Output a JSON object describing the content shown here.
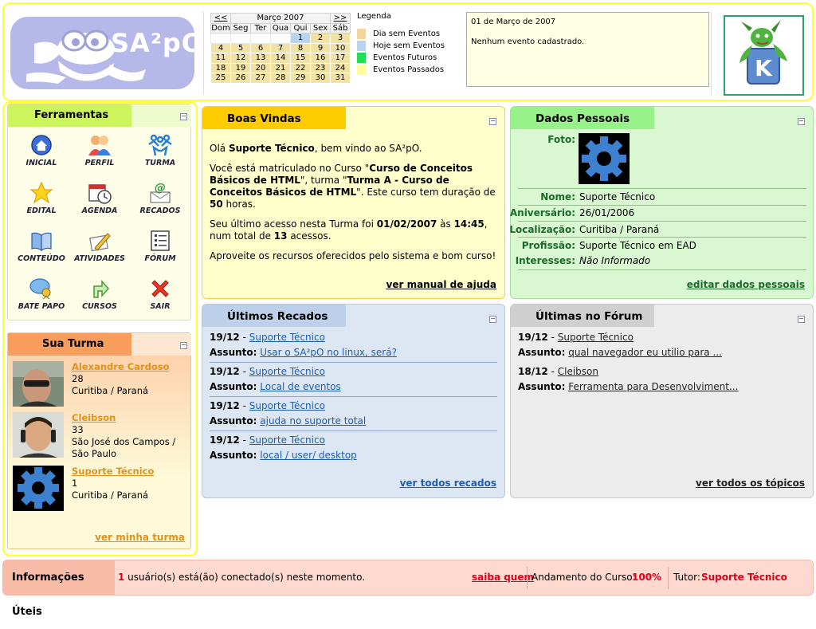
{
  "logo": {
    "text": "SA²pO"
  },
  "calendar": {
    "prev": "<<",
    "next": ">>",
    "month": "Março 2007",
    "weekdays": [
      "Dom",
      "Seg",
      "Ter",
      "Qua",
      "Qui",
      "Sex",
      "Sáb"
    ],
    "weeks": [
      [
        "",
        "",
        "",
        "",
        "1",
        "2",
        "3"
      ],
      [
        "4",
        "5",
        "6",
        "7",
        "8",
        "9",
        "10"
      ],
      [
        "11",
        "12",
        "13",
        "14",
        "15",
        "16",
        "17"
      ],
      [
        "18",
        "19",
        "20",
        "21",
        "22",
        "23",
        "24"
      ],
      [
        "25",
        "26",
        "27",
        "28",
        "29",
        "30",
        "31"
      ]
    ],
    "today": "1"
  },
  "legend": {
    "title": "Legenda",
    "items": [
      {
        "label": "Dia sem Eventos",
        "color": "#f3d39e"
      },
      {
        "label": "Hoje sem Eventos",
        "color": "#b9d4ee"
      },
      {
        "label": "Eventos Futuros",
        "color": "#22dd55"
      },
      {
        "label": "Eventos Passados",
        "color": "#ffff99"
      }
    ]
  },
  "event_box": {
    "date": "01 de Março de 2007",
    "message": "Nenhum evento cadastrado."
  },
  "tools": {
    "title": "Ferramentas",
    "items": [
      {
        "label": "INICIAL",
        "icon": "home-icon"
      },
      {
        "label": "PERFIL",
        "icon": "profile-icon"
      },
      {
        "label": "TURMA",
        "icon": "class-icon"
      },
      {
        "label": "EDITAL",
        "icon": "star-icon"
      },
      {
        "label": "AGENDA",
        "icon": "calendar-clock-icon"
      },
      {
        "label": "RECADOS",
        "icon": "message-icon"
      },
      {
        "label": "CONTEÚDO",
        "icon": "book-icon"
      },
      {
        "label": "ATIVIDADES",
        "icon": "pencil-icon"
      },
      {
        "label": "FÓRUM",
        "icon": "forum-icon"
      },
      {
        "label": "BATE PAPO",
        "icon": "chat-icon"
      },
      {
        "label": "CURSOS",
        "icon": "arrow-icon"
      },
      {
        "label": "SAIR",
        "icon": "exit-icon"
      }
    ]
  },
  "turma": {
    "title": "Sua Turma",
    "members": [
      {
        "name": "Alexandre Cardoso",
        "age": "28",
        "city": "Curitiba / Paraná"
      },
      {
        "name": "Cleibson",
        "age": "33",
        "city": "São José dos Campos / São Paulo"
      },
      {
        "name": "Suporte Técnico",
        "age": "1",
        "city": "Curitiba / Paraná"
      }
    ],
    "link": "ver minha turma"
  },
  "welcome": {
    "title": "Boas Vindas",
    "p1_pre": "Olá ",
    "p1_name": "Suporte Técnico",
    "p1_post": ", bem vindo ao SA²pO.",
    "p2_a": "Você está matriculado no Curso \"",
    "p2_course": "Curso de Conceitos Básicos de HTML",
    "p2_b": "\", turma \"",
    "p2_class": "Turma A - Curso de Conceitos Básicos de HTML",
    "p2_c": "\". Este curso tem duração de ",
    "p2_hours": "50",
    "p2_d": " horas.",
    "p3_a": "Seu último acesso nesta Turma foi ",
    "p3_date": "01/02/2007",
    "p3_b": " às ",
    "p3_time": "14:45",
    "p3_c": ", num total de ",
    "p3_count": "13",
    "p3_d": " acessos.",
    "p4": "Aproveite os recursos oferecidos pelo sistema e bom curso!",
    "link": "ver manual de ajuda"
  },
  "personal": {
    "title": "Dados Pessoais",
    "photo_label": "Foto:",
    "fields": [
      {
        "label": "Nome:",
        "value": "Suporte Técnico"
      },
      {
        "label": "Aniversário:",
        "value": "26/01/2006"
      },
      {
        "label": "Localização:",
        "value": "Curitiba / Paraná"
      },
      {
        "label": "Profissão:",
        "value": "Suporte Técnico em EAD"
      },
      {
        "label": "Interesses:",
        "value": "Não Informado"
      }
    ],
    "link": "editar dados pessoais"
  },
  "recados": {
    "title": "Últimos Recados",
    "subject_label": "Assunto:",
    "items": [
      {
        "date": "19/12",
        "author": "Suporte Técnico",
        "subject": "Usar o SA²pO no linux, será?"
      },
      {
        "date": "19/12",
        "author": "Suporte Técnico",
        "subject": "Local de eventos"
      },
      {
        "date": "19/12",
        "author": "Suporte Técnico",
        "subject": "ajuda no suporte total"
      },
      {
        "date": "19/12",
        "author": "Suporte Técnico",
        "subject": "local / user/ desktop"
      }
    ],
    "link": "ver todos recados"
  },
  "forum": {
    "title": "Últimas no Fórum",
    "subject_label": "Assunto:",
    "items": [
      {
        "date": "19/12",
        "author": "Suporte Técnico",
        "subject": "qual navegador eu utilio para ..."
      },
      {
        "date": "18/12",
        "author": "Cleibson",
        "subject": "Ferramenta para Desenvolviment..."
      }
    ],
    "link": "ver todos os tópicos"
  },
  "footer": {
    "label": "Informações Úteis",
    "online_count": "1",
    "online_text": " usuário(s) está(ão) conectado(s) neste momento.",
    "who_link": "saiba quem",
    "progress_label": "Andamento do Curso:",
    "progress_value": "100%",
    "tutor_label": "Tutor:",
    "tutor_name": "Suporte Técnico"
  }
}
